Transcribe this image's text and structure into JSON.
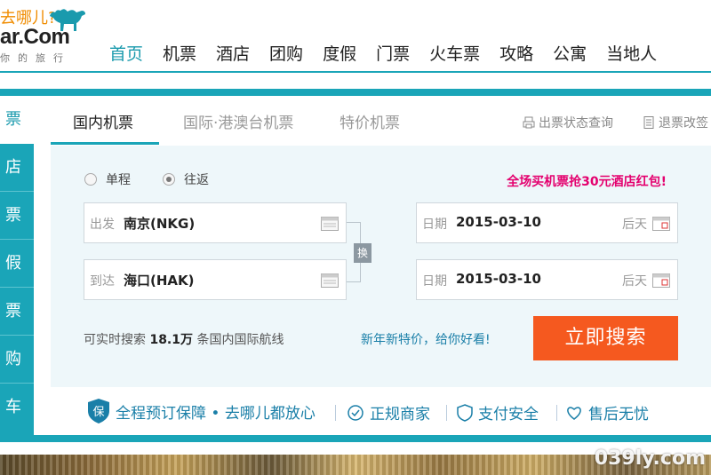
{
  "header": {
    "logo_top": "去哪儿?",
    "logo_main": "ar.Com",
    "logo_sub": "你的旅行",
    "nav": [
      "首页",
      "机票",
      "酒店",
      "团购",
      "度假",
      "门票",
      "火车票",
      "攻略",
      "公寓",
      "当地人"
    ],
    "active_nav": "首页"
  },
  "sidebar": {
    "items": [
      "票",
      "店",
      "票",
      "假",
      "票",
      "购",
      "车"
    ]
  },
  "tabs": {
    "items": [
      "国内机票",
      "国际·港澳台机票",
      "特价机票"
    ],
    "tools": [
      "出票状态查询",
      "退票改签"
    ]
  },
  "form": {
    "trip_types": [
      "单程",
      "往返"
    ],
    "selected_trip": "往返",
    "promo": "全场买机票抢30元酒店红包!",
    "depart": {
      "label": "出发",
      "value": "南京(NKG)"
    },
    "arrive": {
      "label": "到达",
      "value": "海口(HAK)"
    },
    "swap_label": "换",
    "date1": {
      "label": "日期",
      "value": "2015-03-10",
      "day": "后天"
    },
    "date2": {
      "label": "日期",
      "value": "2015-03-10",
      "day": "后天"
    },
    "info_prefix": "可实时搜索",
    "info_count": "18.1万",
    "info_suffix": "条国内国际航线",
    "slogan": "新年新特价，给你好看!",
    "search_button": "立即搜索"
  },
  "guarantee": {
    "items": [
      "全程预订保障 • 去哪儿都放心",
      "正规商家",
      "支付安全",
      "售后无忧"
    ]
  },
  "watermark": "039ly.com",
  "colors": {
    "teal": "#1aa5b8",
    "orange": "#f5591f",
    "promo": "#e4006e",
    "link_blue": "#1a7fa8"
  }
}
